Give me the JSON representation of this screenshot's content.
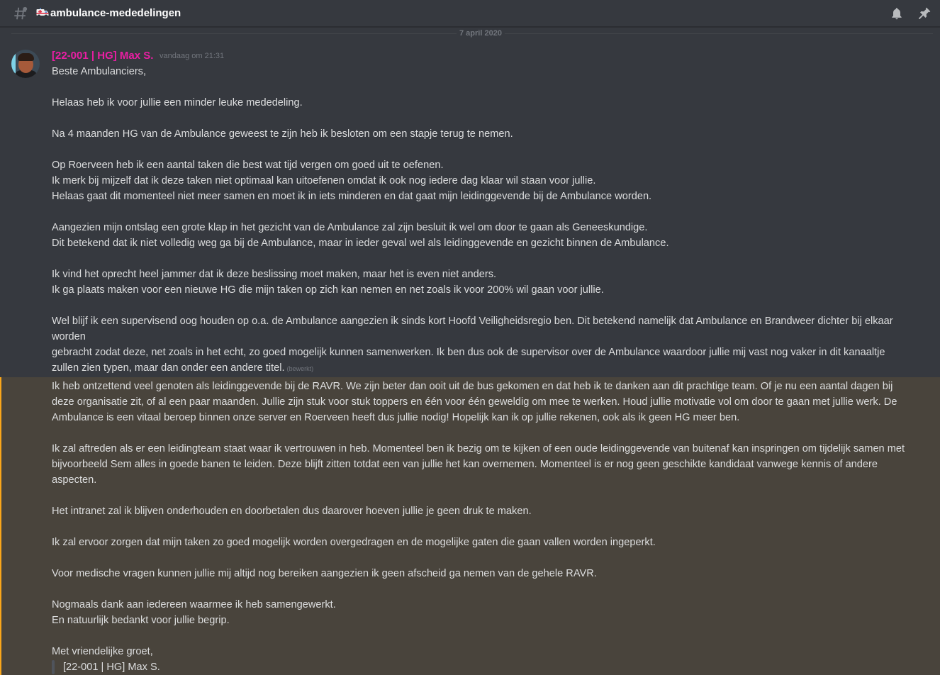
{
  "header": {
    "channel_emoji": "ambulance-emoji",
    "channel_name": "ambulance-mededelingen",
    "icons": [
      "hash-icon",
      "bell-icon",
      "pin-icon"
    ]
  },
  "divider": {
    "date": "7 april 2020"
  },
  "message": {
    "author": "[22-001 | HG] Max S.",
    "timestamp": "vandaag om 21:31",
    "author_color": "#e91ea3",
    "edited_label": "(bewerkt)",
    "lines": [
      "Beste Ambulanciers,",
      "",
      "Helaas heb ik voor jullie een minder leuke mededeling.",
      "",
      "Na 4 maanden HG van de Ambulance geweest te zijn heb ik besloten om een stapje terug te nemen.",
      "",
      "Op Roerveen heb ik een aantal taken die best wat tijd vergen om goed uit te oefenen.",
      "Ik merk bij mijzelf dat ik deze taken niet optimaal kan uitoefenen omdat ik ook nog iedere dag klaar wil staan voor jullie.",
      "Helaas gaat dit momenteel niet meer samen en moet ik in iets minderen en dat gaat mijn leidinggevende bij de Ambulance worden.",
      "",
      "Aangezien mijn ontslag een grote klap in het gezicht van de Ambulance zal zijn besluit ik wel om door te gaan als Geneeskundige.",
      "Dit betekend dat ik niet volledig weg ga bij de Ambulance, maar in ieder geval wel als leidinggevende en gezicht binnen de Ambulance.",
      "",
      "Ik vind het oprecht heel jammer dat ik deze beslissing moet maken, maar het is even niet anders.",
      "Ik ga plaats maken voor een nieuwe HG die mijn taken op zich kan nemen en net zoals ik voor 200% wil gaan voor jullie.",
      "",
      "Wel blijf ik een supervisend oog houden op o.a. de Ambulance aangezien ik sinds kort Hoofd Veiligheidsregio ben. Dit betekend namelijk dat Ambulance en Brandweer dichter bij elkaar",
      "worden",
      "gebracht zodat deze, net zoals in het echt, zo goed mogelijk kunnen samenwerken. Ik ben dus ook de supervisor over de Ambulance waardoor jullie mij vast nog vaker in dit kanaaltje",
      "zullen zien typen, maar dan onder een andere titel."
    ],
    "lines2": [
      "Ik heb ontzettend veel genoten als leidinggevende bij de RAVR. We zijn beter dan ooit uit de bus gekomen en dat heb ik te danken aan dit prachtige team. Of je nu een aantal dagen bij",
      "deze organisatie zit, of al een paar maanden. Jullie zijn stuk voor stuk toppers en één voor één geweldig om mee te werken. Houd jullie motivatie vol om door te gaan met jullie werk. De",
      "Ambulance is een vitaal beroep binnen onze server en Roerveen heeft dus jullie nodig! Hopelijk kan ik op jullie rekenen, ook als ik geen HG meer ben.",
      "",
      "Ik zal aftreden als er een leidingteam staat waar ik vertrouwen in heb. Momenteel ben ik bezig om te kijken of een oude leidinggevende van buitenaf kan inspringen om tijdelijk samen met",
      "bijvoorbeeld Sem alles in goede banen te leiden. Deze blijft zitten totdat een van jullie het kan overnemen. Momenteel is er nog geen geschikte kandidaat vanwege kennis of andere",
      "aspecten.",
      "",
      "Het intranet zal ik blijven onderhouden en doorbetalen dus daarover hoeven jullie je geen druk te maken.",
      "",
      "Ik zal ervoor zorgen dat mijn taken zo goed mogelijk worden overgedragen en de mogelijke gaten die gaan vallen worden ingeperkt.",
      "",
      "Voor medische vragen kunnen jullie mij altijd nog bereiken aangezien ik geen afscheid ga nemen van de gehele RAVR.",
      "",
      "Nogmaals dank aan iedereen waarmee ik heb samengewerkt.",
      "En natuurlijk bedankt voor jullie begrip.",
      "",
      "Met vriendelijke groet,"
    ],
    "quote": "[22-001 | HG] Max S.",
    "highlight_color": "#faa61a"
  }
}
